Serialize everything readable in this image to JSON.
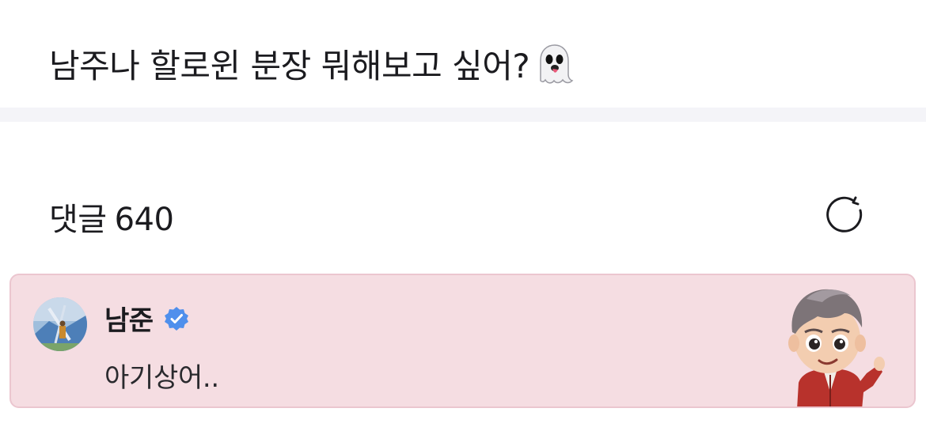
{
  "post": {
    "text": "남주나 할로윈 분장 뭐해보고 싶어?",
    "emoji": "ghost-icon"
  },
  "comments": {
    "label": "댓글",
    "count": "640",
    "refresh_icon": "refresh-icon"
  },
  "comment": {
    "author": "남준",
    "verified_icon": "verified-badge-icon",
    "verified_color": "#4f8fec",
    "body": "아기상어..",
    "background": "#f5dde2",
    "sticker": "character-sticker"
  }
}
